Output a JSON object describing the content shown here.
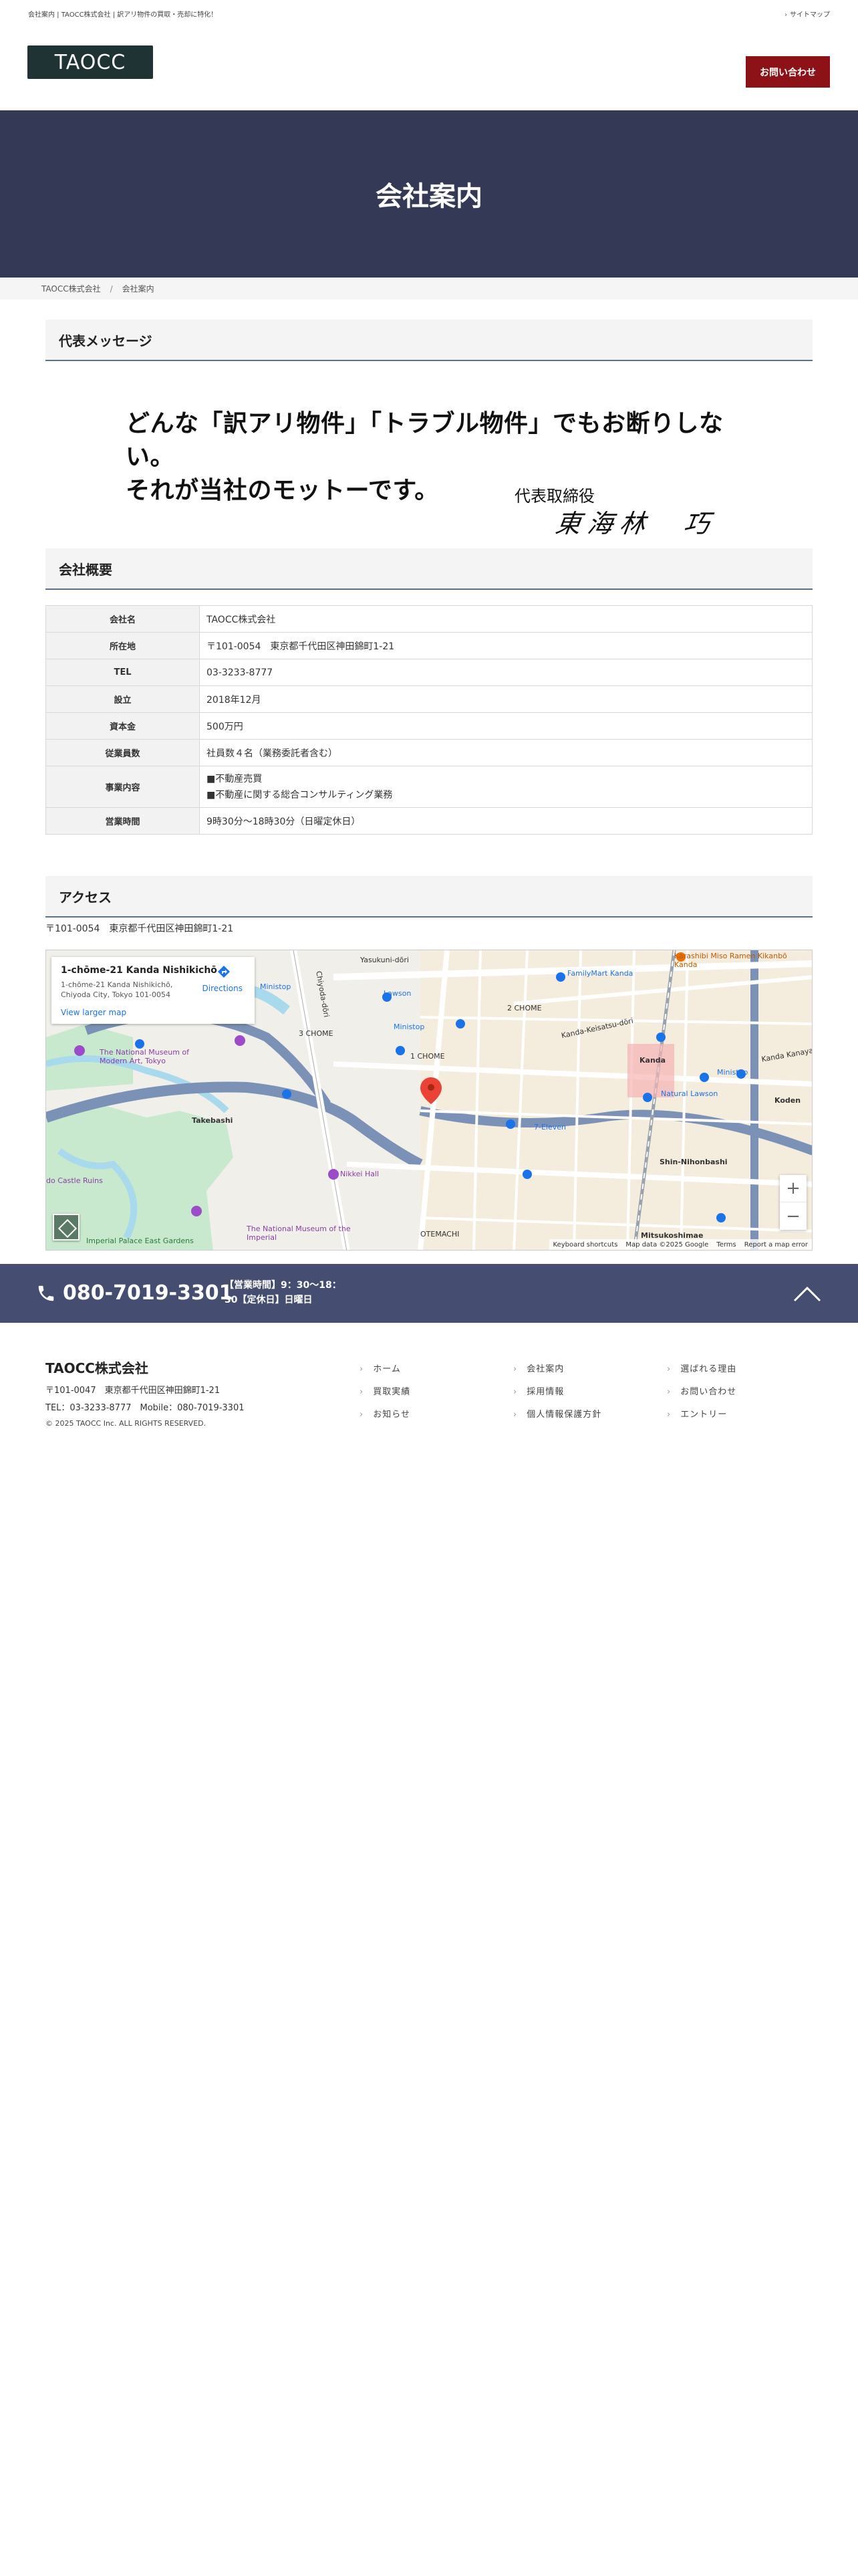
{
  "topbar": {
    "tagline": "会社案内 | TAOCC株式会社 | 訳アリ物件の買取・売却に特化！",
    "sitemap": "サイトマップ"
  },
  "header": {
    "logo": "TAOCC",
    "contact_button": "お問い合わせ",
    "contact_color": "#8d1218"
  },
  "hero": {
    "title": "会社案内",
    "bg_color": "#343a55"
  },
  "breadcrumb": {
    "items": [
      "TAOCC株式会社",
      "会社案内"
    ],
    "separator": "/"
  },
  "message_section": {
    "heading": "代表メッセージ",
    "line1": "どんな「訳アリ物件」「トラブル物件」でもお断りしない。",
    "line2": "それが当社のモットーです。",
    "ceo_title": "代表取締役",
    "signature": "東海林　巧"
  },
  "overview_section": {
    "heading": "会社概要",
    "rows": [
      {
        "label": "会社名",
        "value": "TAOCC株式会社"
      },
      {
        "label": "所在地",
        "value": "〒101-0054　東京都千代田区神田錦町1-21"
      },
      {
        "label": "TEL",
        "value": "03-3233-8777"
      },
      {
        "label": "設立",
        "value": "2018年12月"
      },
      {
        "label": "資本金",
        "value": "500万円"
      },
      {
        "label": "従業員数",
        "value": "社員数４名（業務委託者含む）"
      },
      {
        "label": "事業内容",
        "value_lines": [
          "■不動産売買",
          "■不動産に関する総合コンサルティング業務"
        ]
      },
      {
        "label": "営業時間",
        "value": "9時30分〜18時30分（日曜定休日）"
      }
    ]
  },
  "access_section": {
    "heading": "アクセス",
    "address": "〒101-0054　東京都千代田区神田錦町1-21"
  },
  "map": {
    "card_name": "1-chōme-21 Kanda Nishikichō",
    "card_address": "1-chōme-21 Kanda Nishikichō, Chiyoda City, Tokyo 101-0054",
    "directions": "Directions",
    "larger_map": "View larger map",
    "zoom_in": "+",
    "zoom_out": "−",
    "attribution": [
      "Keyboard shortcuts",
      "Map data ©2025 Google",
      "Terms",
      "Report a map error"
    ],
    "labels": {
      "lawson": "Lawson",
      "familymart_kanda": "FamilyMart Kanda",
      "ministop1": "Ministop",
      "ministop2": "Ministop",
      "ministop3": "Ministop",
      "kanda": "Kanda",
      "takebashi": "Takebashi",
      "nmoma": "The National Museum of Modern Art, Tokyo",
      "nikkei": "Nikkei Hall",
      "castle": "do Castle Ruins",
      "imperial": "Imperial Palace East Gardens",
      "ntm": "The National Museum of the Imperial",
      "seven": "7-Eleven",
      "natural_lawson": "Natural Lawson",
      "shin_nihonbashi": "Shin-Nihonbashi",
      "mitsukoshimae": "Mitsukoshimae",
      "otemachi": "OTEMACHI",
      "chome3": "3 CHOME",
      "chome1": "1 CHOME",
      "chome2": "2 CHOME",
      "karashibi": "Karashibi Miso Ramen Kikanbō Kanda",
      "koden": "Koden",
      "chiyoda_dori": "Chiyoda-dōri",
      "kanda_keisatsu": "Kanda-Keisatsu-dōri",
      "kanda_kanaya": "Kanda Kanaya",
      "yasukuni": "Yasukuni-dōri"
    }
  },
  "phonebar": {
    "phone": "080-7019-3301",
    "hours_line1": "【営業時間】9：30〜18：",
    "hours_line2": "30【定休日】日曜日",
    "bg_color": "#454d70"
  },
  "footer": {
    "company": "TAOCC株式会社",
    "address": "〒101-0047　東京都千代田区神田錦町1-21",
    "tel": "TEL：03-3233-8777　Mobile：080-7019-3301",
    "copyright": "© 2025 TAOCC Inc. ALL RIGHTS RESERVED.",
    "links": [
      "ホーム",
      "会社案内",
      "選ばれる理由",
      "買取実績",
      "採用情報",
      "お問い合わせ",
      "お知らせ",
      "個人情報保護方針",
      "エントリー"
    ]
  }
}
